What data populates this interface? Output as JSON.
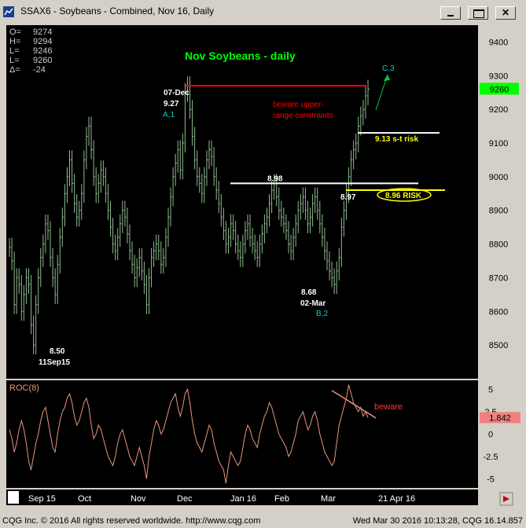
{
  "window": {
    "title": "SSAX6 - Soybeans - Combined, Nov 16, Daily"
  },
  "ohlc": [
    {
      "label": "O=",
      "value": "9274"
    },
    {
      "label": "H=",
      "value": "9294"
    },
    {
      "label": "L=",
      "value": "9246"
    },
    {
      "label": "L=",
      "value": "9260"
    },
    {
      "label": "Δ=",
      "value": "-24"
    }
  ],
  "status": {
    "left": "CQG Inc. © 2016 All rights reserved worldwide. http://www.cqg.com",
    "right": "Wed Mar 30 2016 10:13:28, CQG 16.14.857"
  },
  "colors": {
    "chart_bg": "#000000",
    "bars": "#8fbc8f",
    "roc_line": "#e9967a",
    "title_green": "#00ff00",
    "resistance_red": "#ff0000",
    "support_yellow": "#ffff00",
    "cyan": "#00cccc"
  },
  "chart_data": [
    {
      "type": "bar",
      "title": "Nov Soybeans - daily",
      "price_panel": {
        "ylim": [
          8400,
          9450
        ],
        "y_ticks": [
          "9400",
          "9300",
          "9200",
          "9100",
          "9000",
          "8900",
          "8800",
          "8700",
          "8600",
          "8500"
        ],
        "last_price": "9260",
        "x_labels": [
          "Sep 15",
          "Oct",
          "Nov",
          "Dec",
          "Jan 16",
          "Feb",
          "Mar",
          "21 Apr 16"
        ],
        "series": [
          {
            "values": [
              8790,
              8750,
              8620,
              8700,
              8680,
              8600,
              8650,
              8700,
              8680,
              8560,
              8500,
              8620,
              8700,
              8760,
              8800,
              8860,
              8840,
              8760,
              8700,
              8650,
              8740,
              8820,
              8880,
              8950,
              9000,
              9050,
              8980,
              8920,
              8880,
              8900,
              8950,
              9050,
              9120,
              9150,
              9080,
              9000,
              8950,
              8980,
              9020,
              9000,
              8950,
              8900,
              8850,
              8800,
              8780,
              8820,
              8860,
              8900,
              8880,
              8830,
              8780,
              8740,
              8700,
              8730,
              8760,
              8720,
              8680,
              8620,
              8700,
              8760,
              8780,
              8800,
              8780,
              8740,
              8760,
              8820,
              8880,
              8940,
              9000,
              9040,
              9080,
              9020,
              9100,
              9250,
              9270,
              9200,
              9120,
              9050,
              9000,
              8980,
              8950,
              9000,
              9050,
              9080,
              9060,
              9000,
              8960,
              8920,
              8880,
              8840,
              8800,
              8820,
              8860,
              8840,
              8800,
              8780,
              8760,
              8800,
              8840,
              8860,
              8820,
              8800,
              8780,
              8760,
              8800,
              8830,
              8860,
              8880,
              8920,
              8960,
              8980,
              8940,
              8900,
              8880,
              8860,
              8840,
              8800,
              8780,
              8820,
              8860,
              8900,
              8920,
              8940,
              8900,
              8860,
              8880,
              8920,
              8940,
              8900,
              8860,
              8820,
              8780,
              8750,
              8720,
              8700,
              8680,
              8720,
              8760,
              8850,
              8900,
              8950,
              9000,
              9050,
              9080,
              9100,
              9150,
              9180,
              9200,
              9240,
              9260
            ]
          }
        ],
        "annotations": {
          "peak_date": "07-Dec",
          "peak_value": "9.27",
          "wave_a": "A,1",
          "beware_text_1": "beware upper-",
          "beware_text_2": "range constraints",
          "resistance": 9270,
          "support_898_label": "8.98",
          "support_898": 8980,
          "label_897": "8.97",
          "risk_896_label": "8.96 RISK",
          "risk_896": 8960,
          "risk_913_label": "9.13 s-t risk",
          "risk_913": 9130,
          "low_mar_value": "8.68",
          "low_mar_date": "02-Mar",
          "wave_b": "B,2",
          "low_sep_value": "8.50",
          "low_sep_date": "11Sep15",
          "wave_c": "C,3"
        }
      },
      "indicator_panel": {
        "type": "line",
        "name": "ROC(8)",
        "ylim": [
          -6,
          6
        ],
        "y_ticks": [
          "5",
          "2.5",
          "0",
          "-2.5",
          "-5"
        ],
        "last_value": "1.842",
        "divergence_label": "beware",
        "values": [
          0.5,
          -0.5,
          -2,
          -1,
          0.5,
          1.5,
          0.5,
          -1,
          -3,
          -4,
          -2.5,
          -1,
          0,
          1.5,
          2.5,
          3,
          1.5,
          0,
          -1.5,
          -2,
          0,
          1.5,
          2.5,
          3,
          4,
          4.5,
          3.5,
          2,
          1,
          1.5,
          2.5,
          3.5,
          4,
          3,
          1,
          -0.5,
          0,
          1,
          0.5,
          -0.5,
          -1.5,
          -2.5,
          -3,
          -3.5,
          -2.5,
          -1,
          0,
          0.5,
          -0.5,
          -1.5,
          -2.5,
          -3,
          -3.5,
          -2.5,
          -1.5,
          -2.5,
          -3.5,
          -5,
          -2.5,
          -1,
          0.5,
          1.5,
          1,
          0,
          0.5,
          1.5,
          2.5,
          3.5,
          4,
          4.5,
          3,
          2,
          3,
          4.5,
          5,
          3.5,
          1.5,
          0,
          -1,
          -1.5,
          -2,
          -1,
          0,
          1,
          0.5,
          -1,
          -2,
          -3,
          -3.5,
          -4,
          -5.5,
          -3.5,
          -2,
          -2.5,
          -3,
          -3.5,
          -3,
          -1.5,
          0,
          1,
          0.5,
          -0.5,
          -1,
          -1.5,
          0,
          1,
          2,
          2.5,
          3.5,
          3,
          2,
          1,
          0,
          -0.5,
          -1,
          -1.5,
          -2.5,
          -2,
          -1,
          0,
          1.5,
          2,
          2.5,
          1.5,
          0.5,
          1,
          2,
          2.5,
          1.5,
          0,
          -1,
          -2,
          -2.5,
          -3,
          -3.5,
          -3,
          -1,
          1,
          2,
          3,
          4,
          5.5,
          4.5,
          3.5,
          3,
          2.5,
          3,
          2,
          2.5,
          1.842
        ]
      }
    }
  ]
}
